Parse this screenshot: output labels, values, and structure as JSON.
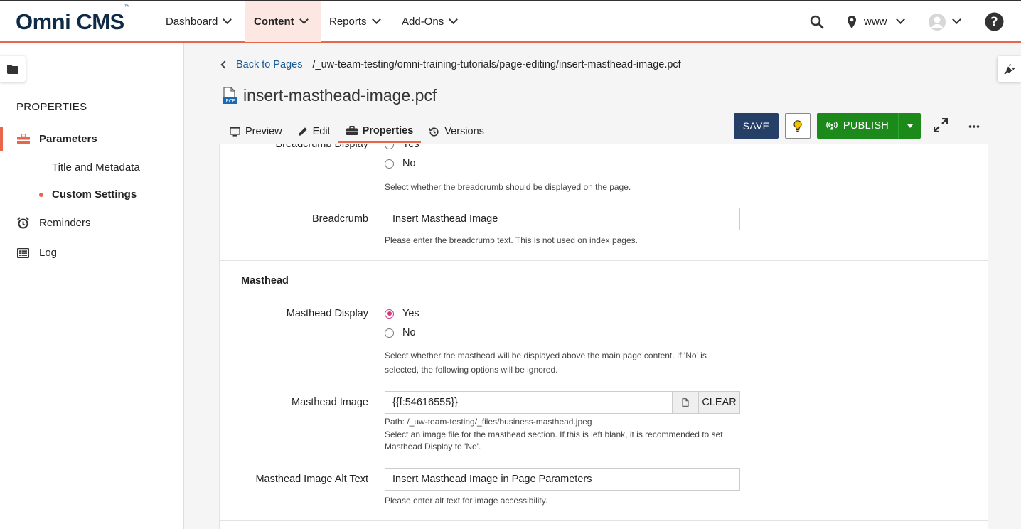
{
  "brand": {
    "name": "Omni CMS",
    "tm": "™"
  },
  "nav": {
    "items": [
      {
        "label": "Dashboard"
      },
      {
        "label": "Content"
      },
      {
        "label": "Reports"
      },
      {
        "label": "Add-Ons"
      }
    ],
    "site": "www"
  },
  "sidebar": {
    "heading": "PROPERTIES",
    "items": [
      {
        "label": "Parameters"
      },
      {
        "label": "Title and Metadata"
      },
      {
        "label": "Custom Settings"
      },
      {
        "label": "Reminders"
      },
      {
        "label": "Log"
      }
    ]
  },
  "breadcrumb": {
    "back": "Back to Pages",
    "path": "/_uw-team-testing/omni-training-tutorials/page-editing/insert-masthead-image.pcf"
  },
  "page": {
    "title": "insert-masthead-image.pcf",
    "file_badge": "PCF"
  },
  "tabs": [
    {
      "label": "Preview"
    },
    {
      "label": "Edit"
    },
    {
      "label": "Properties"
    },
    {
      "label": "Versions"
    }
  ],
  "toolbar": {
    "save": "SAVE",
    "publish": "PUBLISH"
  },
  "form": {
    "breadcrumb_display": {
      "label": "Breadcrumb Display",
      "yes": "Yes",
      "no": "No",
      "help": "Select whether the breadcrumb should be displayed on the page."
    },
    "breadcrumb": {
      "label": "Breadcrumb",
      "value": "Insert Masthead Image",
      "help": "Please enter the breadcrumb text. This is not used on index pages."
    },
    "masthead_section": "Masthead",
    "masthead_display": {
      "label": "Masthead Display",
      "yes": "Yes",
      "no": "No",
      "help1": "Select whether the masthead will be displayed above the main page content. If 'No' is",
      "help2": "selected, the following options will be ignored."
    },
    "masthead_image": {
      "label": "Masthead Image",
      "value": "{{f:54616555}}",
      "clear": "CLEAR",
      "path": "Path: /_uw-team-testing/_files/business-masthead.jpeg",
      "help1": "Select an image file for the masthead section. If this is left blank, it is recommended to set",
      "help2": "Masthead Display to 'No'."
    },
    "masthead_alt": {
      "label": "Masthead Image Alt Text",
      "value": "Insert Masthead Image in Page Parameters",
      "help": "Please enter alt text for image accessibility."
    }
  },
  "colors": {
    "accent": "#e8674a",
    "navy": "#253f66",
    "publish": "#1b8a1b",
    "radio": "#d4357f",
    "link": "#1a5a96"
  }
}
